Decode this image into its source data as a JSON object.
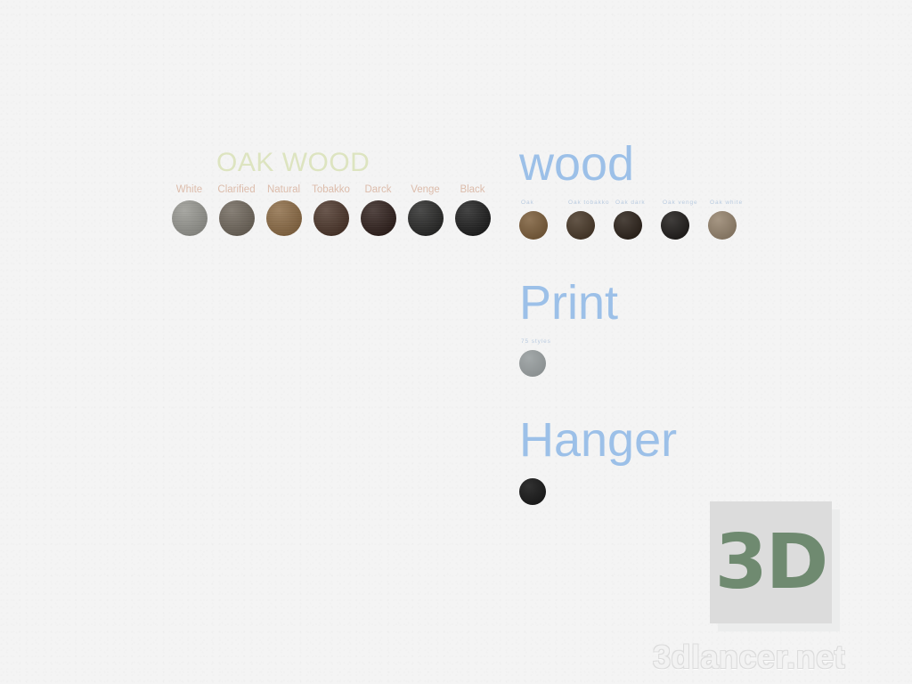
{
  "background_color": "#f4f4f4",
  "oak_wood_panel": {
    "title": "OAK WOOD",
    "title_color": "#dde4c0",
    "label_color": "#dcbcab",
    "swatches": [
      {
        "label": "White",
        "color": "#969690"
      },
      {
        "label": "Clarified",
        "color": "#6f665b"
      },
      {
        "label": "Natural",
        "color": "#8b6a44"
      },
      {
        "label": "Tobakko",
        "color": "#4b3529"
      },
      {
        "label": "Darck",
        "color": "#2f1f1b"
      },
      {
        "label": "Venge",
        "color": "#272726"
      },
      {
        "label": "Black",
        "color": "#1d1d1d"
      }
    ]
  },
  "wood_section": {
    "heading": "wood",
    "heading_color": "#9cc0e8",
    "label_color": "#b9cbe0",
    "swatches": [
      {
        "label": "Oak",
        "color": "#7d5f3c"
      },
      {
        "label": "Oak tobakko",
        "color": "#4a3a2a"
      },
      {
        "label": "Oak dark",
        "color": "#2e241c"
      },
      {
        "label": "Oak venge",
        "color": "#211e1c"
      },
      {
        "label": "Oak white",
        "color": "#97856f"
      }
    ]
  },
  "print_section": {
    "heading": "Print",
    "heading_color": "#9cc0e8",
    "swatches": [
      {
        "label": "75 styles",
        "color": "#999fa0"
      }
    ]
  },
  "hanger_section": {
    "heading": "Hanger",
    "heading_color": "#9cc0e8",
    "swatches": [
      {
        "label": "",
        "color": "#1a1a1a"
      }
    ]
  },
  "logo": {
    "text": "3D",
    "text_color": "#6f8a70",
    "square_color": "#dcdcdc"
  },
  "watermark": {
    "text": "3dlancer.net",
    "color": "#f2f2f2"
  }
}
